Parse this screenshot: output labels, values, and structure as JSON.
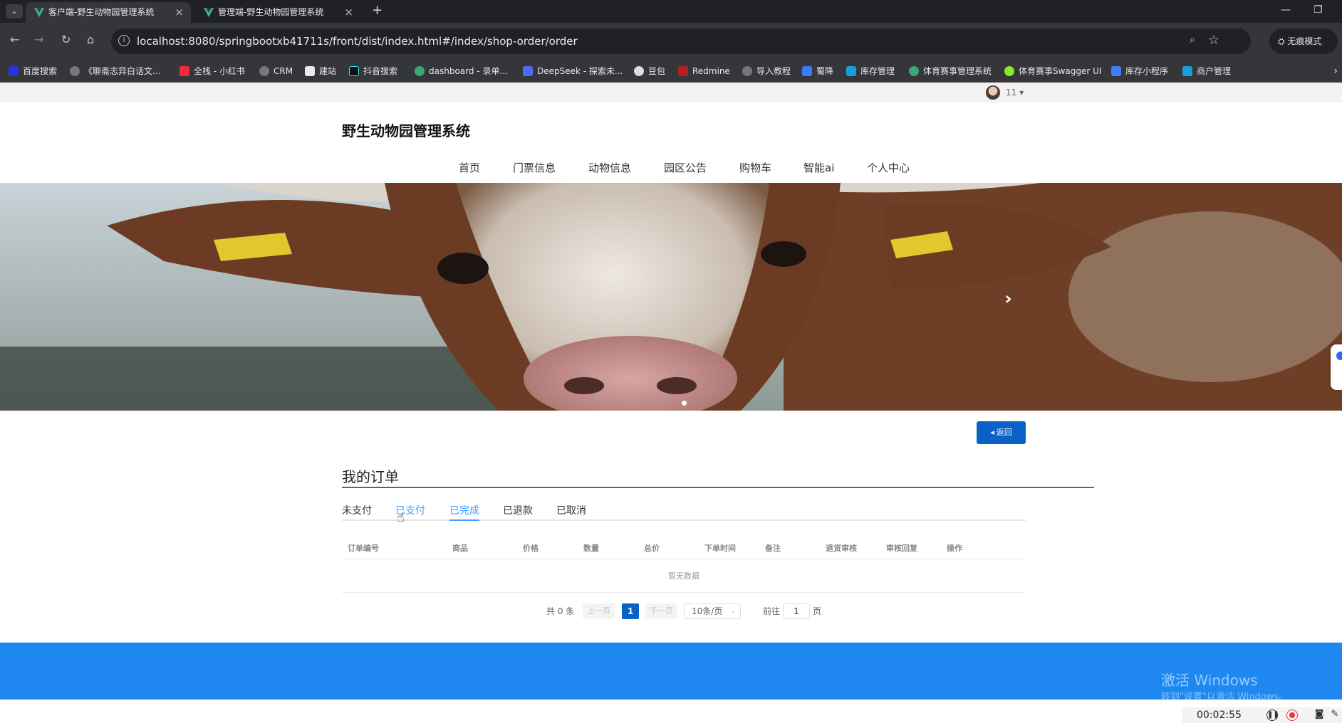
{
  "browser": {
    "tabs": [
      {
        "title": "客户端-野生动物园管理系统",
        "active": true
      },
      {
        "title": "管理端-野生动物园管理系统",
        "active": false
      }
    ],
    "url": "localhost:8080/springbootxb41711s/front/dist/index.html#/index/shop-order/order",
    "incognito_label": "无痕模式",
    "bookmarks": [
      "百度搜索",
      "《聊斋志异白话文...",
      "全栈 - 小红书",
      "CRM",
      "建站",
      "抖音搜索",
      "dashboard - 录单...",
      "DeepSeek - 探索未...",
      "豆包",
      "Redmine",
      "导入教程",
      "蜀降",
      "库存管理",
      "体育赛事管理系统",
      "体育赛事Swagger UI",
      "库存小程序",
      "商户管理"
    ],
    "colors": {
      "tabbar": "#202124",
      "toolbar": "#35363a"
    }
  },
  "user": {
    "name": "11"
  },
  "site": {
    "title": "野生动物园管理系统",
    "nav": [
      "首页",
      "门票信息",
      "动物信息",
      "园区公告",
      "购物车",
      "智能ai",
      "个人中心"
    ],
    "back_label": "返回"
  },
  "orders": {
    "heading": "我的订单",
    "tabs": [
      "未支付",
      "已支付",
      "已完成",
      "已退款",
      "已取消"
    ],
    "active_tab": "已完成",
    "hover_tab": "已支付",
    "columns": [
      "订单编号",
      "商品",
      "价格",
      "数量",
      "总价",
      "下单时间",
      "备注",
      "退货审核",
      "审核回复",
      "操作"
    ],
    "empty_text": "暂无数据"
  },
  "pagination": {
    "total": "共 0 条",
    "prev": "上一页",
    "next": "下一页",
    "current": "1",
    "page_size": "10条/页",
    "goto_label": "前往",
    "goto_value": "1",
    "page_suffix": "页"
  },
  "watermark": {
    "line1": "激活 Windows",
    "line2": "转到\"设置\"以激活 Windows。"
  },
  "recorder": {
    "time": "00:02:55"
  },
  "colors": {
    "accent": "#409eff",
    "primary_btn": "#0a62c9",
    "footer": "#1e88f0"
  }
}
